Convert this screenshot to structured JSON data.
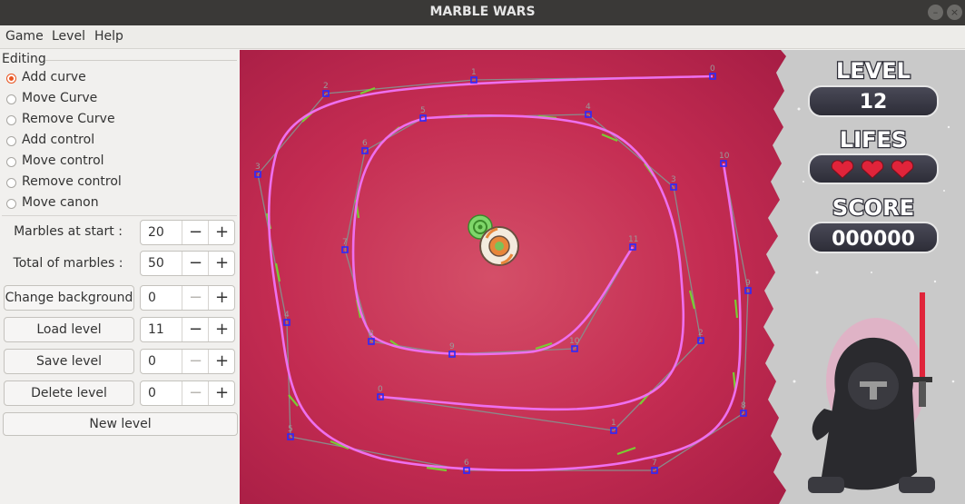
{
  "window": {
    "title": "MARBLE WARS"
  },
  "menu": {
    "items": [
      "Game",
      "Level",
      "Help"
    ]
  },
  "editing": {
    "group_label": "Editing",
    "modes": [
      "Add curve",
      "Move Curve",
      "Remove Curve",
      "Add control",
      "Move control",
      "Remove control",
      "Move canon"
    ],
    "selected_mode": "Add curve"
  },
  "fields": {
    "marbles_at_start": {
      "label": "Marbles at start :",
      "value": "20"
    },
    "total_marbles": {
      "label": "Total of marbles :",
      "value": "50"
    },
    "change_background": {
      "label": "Change background",
      "value": "0"
    },
    "load_level": {
      "label": "Load level",
      "value": "11"
    },
    "save_level": {
      "label": "Save level",
      "value": "0"
    },
    "delete_level": {
      "label": "Delete level",
      "value": "0"
    },
    "new_level": {
      "label": "New level"
    }
  },
  "spin_symbols": {
    "minus": "−",
    "plus": "+"
  },
  "hud": {
    "level_title": "LEVEL",
    "level_value": "12",
    "lifes_title": "LIFES",
    "lives": 3,
    "score_title": "SCORE",
    "score_value": "000000"
  },
  "colors": {
    "background": "#c0284f",
    "curve": "#ee6fee",
    "tangent": "#7acc33",
    "control_line": "#8a8a8a",
    "control_point": "#2a2aff",
    "panel": "#3b3b47",
    "accent_radio": "#e95420"
  },
  "curves": [
    {
      "name": "outer",
      "labels": [
        "0",
        "1",
        "2",
        "3",
        "4",
        "5",
        "6",
        "7",
        "8",
        "9",
        "10"
      ]
    },
    {
      "name": "inner",
      "labels": [
        "0",
        "1",
        "2",
        "3",
        "4",
        "5",
        "6",
        "7",
        "8",
        "9",
        "10",
        "11"
      ]
    }
  ]
}
